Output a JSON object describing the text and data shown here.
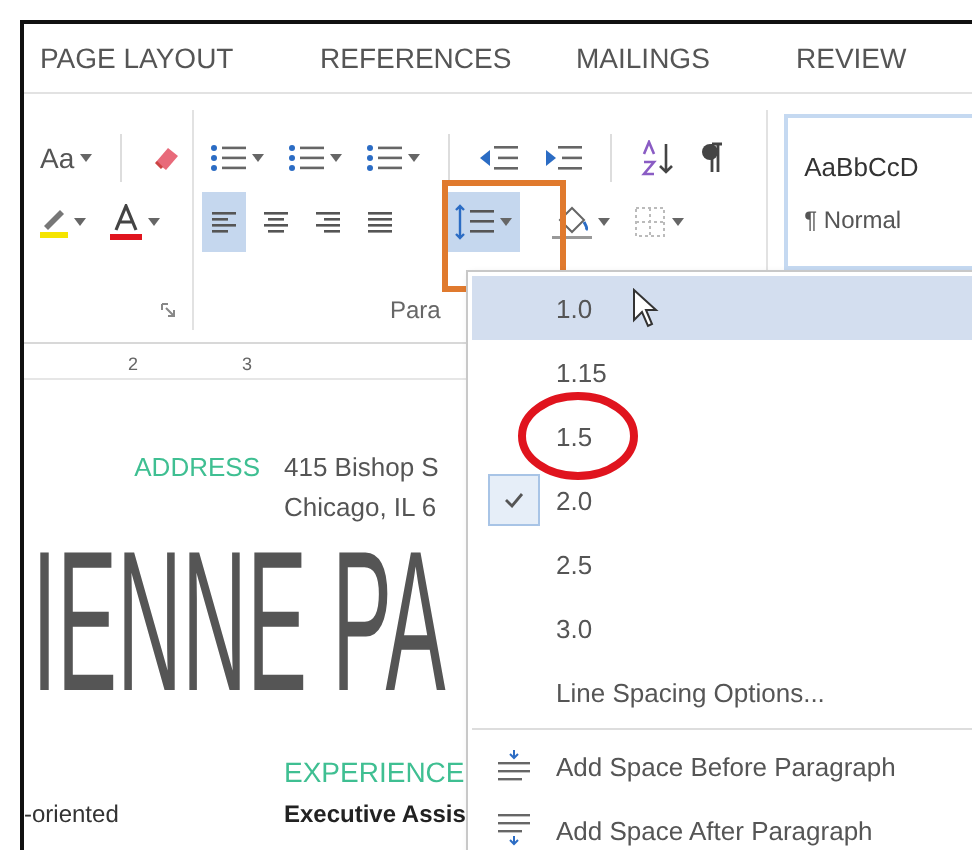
{
  "tabs": [
    {
      "label": "PAGE LAYOUT"
    },
    {
      "label": "REFERENCES"
    },
    {
      "label": "MAILINGS"
    },
    {
      "label": "REVIEW"
    }
  ],
  "ribbon": {
    "change_case_label": "Aa",
    "alignment": [
      {
        "kind": "left",
        "selected": true
      },
      {
        "kind": "center",
        "selected": false
      },
      {
        "kind": "right",
        "selected": false
      },
      {
        "kind": "justify",
        "selected": false
      }
    ],
    "line_spacing": {
      "selected": true,
      "outlined": true
    },
    "group_label": "Para",
    "style": {
      "preview": "AaBbCcD",
      "name": "¶ Normal"
    }
  },
  "document": {
    "ruler_labels": [
      "2",
      "3"
    ],
    "address_label": "ADDRESS",
    "address_lines": [
      "415 Bishop S",
      "Chicago, IL 6"
    ],
    "name": "IENNE PA",
    "section": "EXPERIENCE",
    "left_text": "-oriented",
    "job": "Executive Assis"
  },
  "menu": {
    "spacing": [
      {
        "label": "1.0",
        "hovered": true,
        "checked": false,
        "circled": false
      },
      {
        "label": "1.15",
        "hovered": false,
        "checked": false,
        "circled": false
      },
      {
        "label": "1.5",
        "hovered": false,
        "checked": false,
        "circled": true
      },
      {
        "label": "2.0",
        "hovered": false,
        "checked": true,
        "circled": false
      },
      {
        "label": "2.5",
        "hovered": false,
        "checked": false,
        "circled": false
      },
      {
        "label": "3.0",
        "hovered": false,
        "checked": false,
        "circled": false
      }
    ],
    "options_label": "Line Spacing Options...",
    "actions": [
      {
        "kind": "before",
        "label": "Add Space Before Paragraph"
      },
      {
        "kind": "after",
        "label": "Add Space After Paragraph"
      }
    ]
  }
}
